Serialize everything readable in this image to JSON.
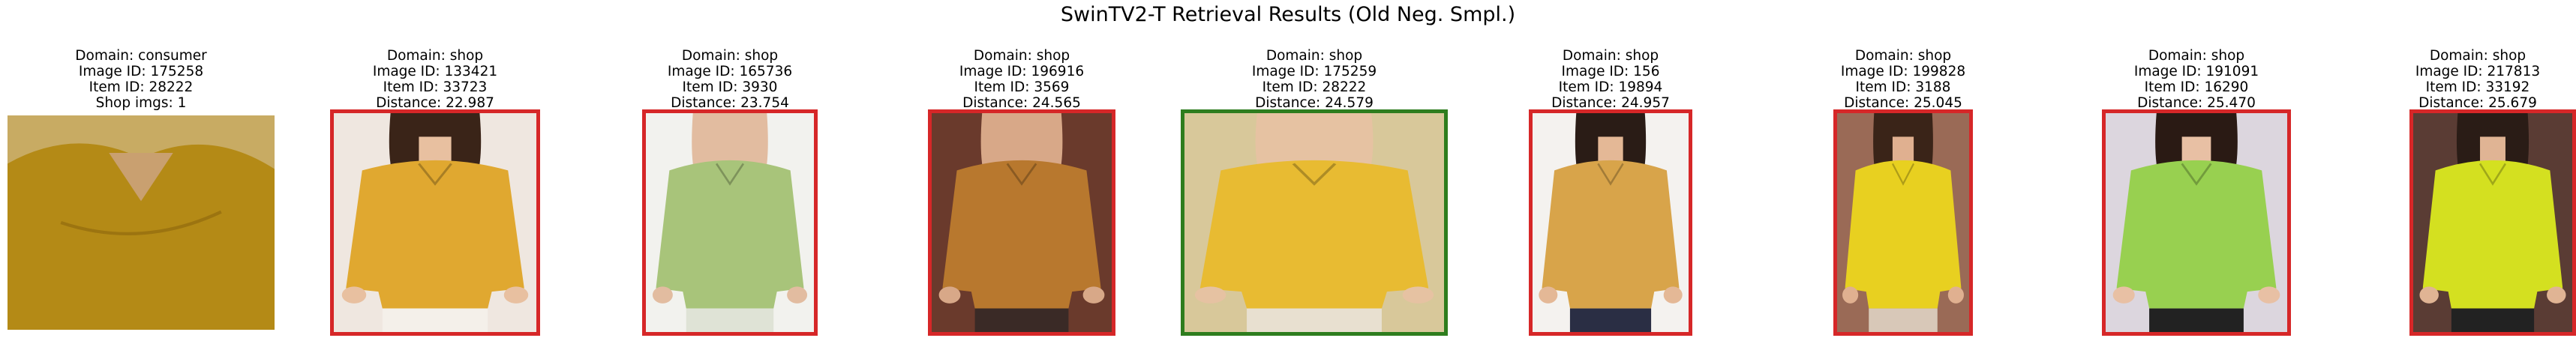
{
  "title": "SwinTV2-T Retrieval Results (Old Neg. Smpl.)",
  "query": {
    "domain": "Domain: consumer",
    "image_id": "Image ID: 175258",
    "item_id": "Item ID: 28222",
    "shop_imgs": "Shop imgs: 1",
    "colors": {
      "bg": "#c8ab63",
      "garment": "#b48a16",
      "skin": "#c9a070"
    }
  },
  "results": [
    {
      "domain": "Domain: shop",
      "image_id": "Image ID: 133421",
      "item_id": "Item ID: 33723",
      "distance": "Distance: 22.987",
      "match": false,
      "colors": {
        "bg": "#efe7e0",
        "garment": "#e0a830",
        "skin": "#e8c0a0",
        "hair": "#3a2418",
        "bottom": "#f4f0ea"
      }
    },
    {
      "domain": "Domain: shop",
      "image_id": "Image ID: 165736",
      "item_id": "Item ID: 3930",
      "distance": "Distance: 23.754",
      "match": false,
      "colors": {
        "bg": "#f2f2ee",
        "garment": "#a8c47a",
        "skin": "#e2bca0",
        "hair": "#e2bca0",
        "bottom": "#dfe3d6"
      }
    },
    {
      "domain": "Domain: shop",
      "image_id": "Image ID: 196916",
      "item_id": "Item ID: 3569",
      "distance": "Distance: 24.565",
      "match": false,
      "colors": {
        "bg": "#6a3a2c",
        "garment": "#b8782e",
        "skin": "#d8a888",
        "hair": "#d8a888",
        "bottom": "#3a2a26"
      }
    },
    {
      "domain": "Domain: shop",
      "image_id": "Image ID: 175259",
      "item_id": "Item ID: 28222",
      "distance": "Distance: 24.579",
      "match": true,
      "colors": {
        "bg": "#d8c89a",
        "garment": "#e8bb32",
        "skin": "#e6c2a2",
        "hair": "#e6c2a2",
        "bottom": "#e8e0d0"
      }
    },
    {
      "domain": "Domain: shop",
      "image_id": "Image ID: 156",
      "item_id": "Item ID: 19894",
      "distance": "Distance: 24.957",
      "match": false,
      "colors": {
        "bg": "#f4f2ef",
        "garment": "#d8a44a",
        "skin": "#e4b896",
        "hair": "#2a1c16",
        "bottom": "#2a2e44"
      }
    },
    {
      "domain": "Domain: shop",
      "image_id": "Image ID: 199828",
      "item_id": "Item ID: 3188",
      "distance": "Distance: 25.045",
      "match": false,
      "colors": {
        "bg": "#9a6a56",
        "garment": "#e8d020",
        "skin": "#e0b090",
        "hair": "#3a2418",
        "bottom": "#d8c8b8"
      }
    },
    {
      "domain": "Domain: shop",
      "image_id": "Image ID: 191091",
      "item_id": "Item ID: 16290",
      "distance": "Distance: 25.470",
      "match": false,
      "colors": {
        "bg": "#dcd6de",
        "garment": "#98d050",
        "skin": "#e8c0a4",
        "hair": "#2a1a14",
        "bottom": "#222222"
      }
    },
    {
      "domain": "Domain: shop",
      "image_id": "Image ID: 217813",
      "item_id": "Item ID: 33192",
      "distance": "Distance: 25.679",
      "match": false,
      "colors": {
        "bg": "#5a3c34",
        "garment": "#d4e020",
        "skin": "#e0b494",
        "hair": "#2a1c16",
        "bottom": "#222222"
      }
    }
  ]
}
